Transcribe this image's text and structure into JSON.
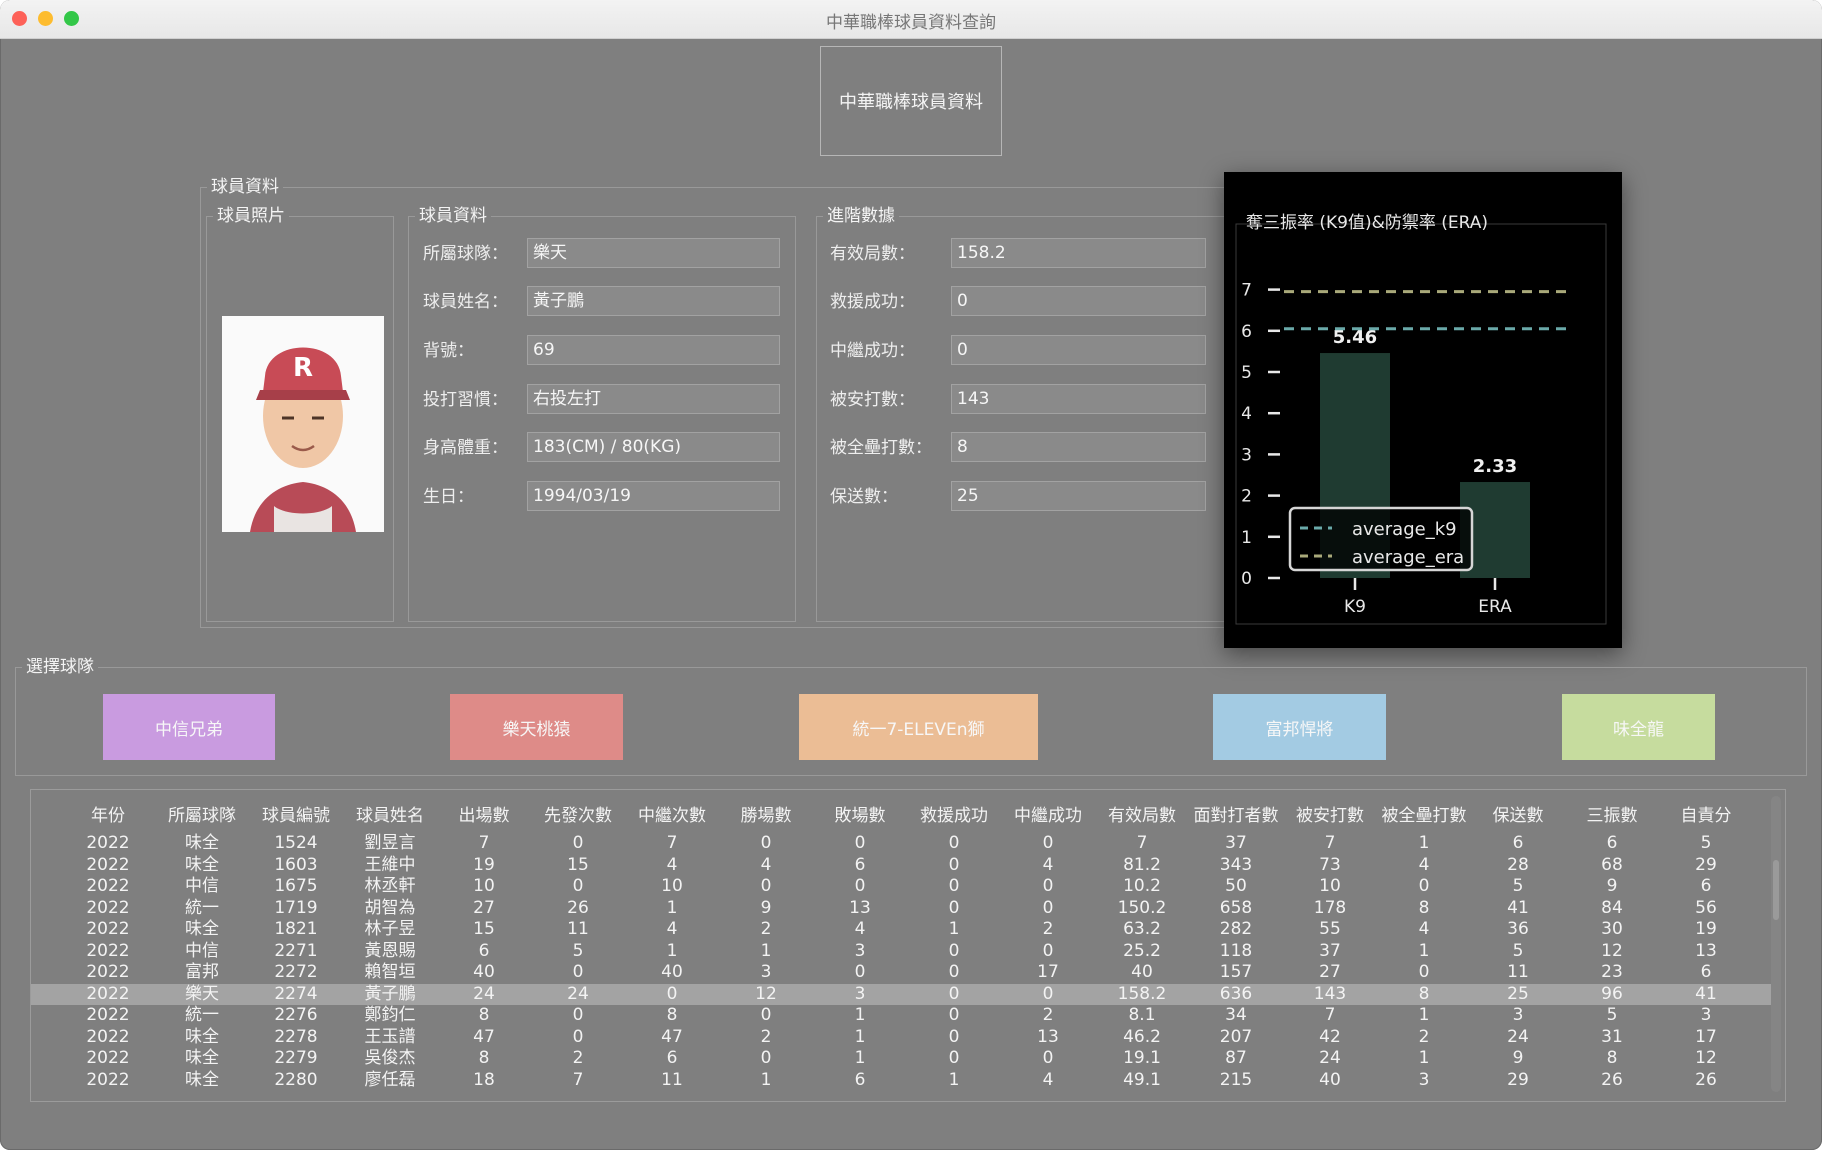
{
  "window": {
    "title": "中華職棒球員資料查詢"
  },
  "header": {
    "title": "中華職棒球員資料"
  },
  "player_section": {
    "label": "球員資料"
  },
  "photo_section": {
    "label": "球員照片",
    "cap_letter": "R"
  },
  "info_section": {
    "label": "球員資料",
    "rows": [
      {
        "label": "所屬球隊：",
        "value": "樂天"
      },
      {
        "label": "球員姓名：",
        "value": "黃子鵬"
      },
      {
        "label": "背號：",
        "value": "69"
      },
      {
        "label": "投打習慣：",
        "value": "右投左打"
      },
      {
        "label": "身高體重：",
        "value": "183(CM) / 80(KG)"
      },
      {
        "label": "生日：",
        "value": "1994/03/19"
      }
    ]
  },
  "advanced_section": {
    "label": "進階數據",
    "rows": [
      {
        "label": "有效局數：",
        "value": "158.2"
      },
      {
        "label": "救援成功：",
        "value": "0"
      },
      {
        "label": "中繼成功：",
        "value": "0"
      },
      {
        "label": "被安打數：",
        "value": "143"
      },
      {
        "label": "被全壘打數：",
        "value": "8"
      },
      {
        "label": "保送數：",
        "value": "25"
      }
    ]
  },
  "chart_data": {
    "type": "bar",
    "title": "奪三振率 (K9值)&防禦率 (ERA)",
    "categories": [
      "K9",
      "ERA"
    ],
    "values": [
      5.46,
      2.33
    ],
    "value_labels": [
      "5.46",
      "2.33"
    ],
    "yticks": [
      "0",
      "1",
      "2",
      "3",
      "4",
      "5",
      "6",
      "7"
    ],
    "ylim": [
      0,
      7
    ],
    "reference_lines": [
      {
        "name": "average_k9",
        "value": 6.05,
        "color": "#6aa9a9"
      },
      {
        "name": "average_era",
        "value": 6.95,
        "color": "#a9a97a"
      }
    ],
    "bar_color": "#1f3b31",
    "legend_position": "lower-left",
    "grid": false
  },
  "team_section": {
    "label": "選擇球隊",
    "teams": [
      {
        "name": "中信兄弟",
        "color": "#c99be0"
      },
      {
        "name": "樂天桃猿",
        "color": "#de8b88"
      },
      {
        "name": "統一7-ELEVEn獅",
        "color": "#ebbd95"
      },
      {
        "name": "富邦悍將",
        "color": "#a3cbe3"
      },
      {
        "name": "味全龍",
        "color": "#c6dc9e"
      }
    ]
  },
  "table": {
    "columns": [
      "年份",
      "所屬球隊",
      "球員編號",
      "球員姓名",
      "出場數",
      "先發次數",
      "中繼次數",
      "勝場數",
      "敗場數",
      "救援成功",
      "中繼成功",
      "有效局數",
      "面對打者數",
      "被安打數",
      "被全壘打數",
      "保送數",
      "三振數",
      "自責分"
    ],
    "selected_index": 7,
    "rows": [
      [
        "2022",
        "味全",
        "1524",
        "劉昱言",
        "7",
        "0",
        "7",
        "0",
        "0",
        "0",
        "0",
        "7",
        "37",
        "7",
        "1",
        "6",
        "6",
        "5"
      ],
      [
        "2022",
        "味全",
        "1603",
        "王維中",
        "19",
        "15",
        "4",
        "4",
        "6",
        "0",
        "4",
        "81.2",
        "343",
        "73",
        "4",
        "28",
        "68",
        "29"
      ],
      [
        "2022",
        "中信",
        "1675",
        "林丞軒",
        "10",
        "0",
        "10",
        "0",
        "0",
        "0",
        "0",
        "10.2",
        "50",
        "10",
        "0",
        "5",
        "9",
        "6"
      ],
      [
        "2022",
        "統一",
        "1719",
        "胡智為",
        "27",
        "26",
        "1",
        "9",
        "13",
        "0",
        "0",
        "150.2",
        "658",
        "178",
        "8",
        "41",
        "84",
        "56"
      ],
      [
        "2022",
        "味全",
        "1821",
        "林子昱",
        "15",
        "11",
        "4",
        "2",
        "4",
        "1",
        "2",
        "63.2",
        "282",
        "55",
        "4",
        "36",
        "30",
        "19"
      ],
      [
        "2022",
        "中信",
        "2271",
        "黃恩賜",
        "6",
        "5",
        "1",
        "1",
        "3",
        "0",
        "0",
        "25.2",
        "118",
        "37",
        "1",
        "5",
        "12",
        "13"
      ],
      [
        "2022",
        "富邦",
        "2272",
        "賴智垣",
        "40",
        "0",
        "40",
        "3",
        "0",
        "0",
        "17",
        "40",
        "157",
        "27",
        "0",
        "11",
        "23",
        "6"
      ],
      [
        "2022",
        "樂天",
        "2274",
        "黃子鵬",
        "24",
        "24",
        "0",
        "12",
        "3",
        "0",
        "0",
        "158.2",
        "636",
        "143",
        "8",
        "25",
        "96",
        "41"
      ],
      [
        "2022",
        "統一",
        "2276",
        "鄭鈞仁",
        "8",
        "0",
        "8",
        "0",
        "1",
        "0",
        "2",
        "8.1",
        "34",
        "7",
        "1",
        "3",
        "5",
        "3"
      ],
      [
        "2022",
        "味全",
        "2278",
        "王玉譜",
        "47",
        "0",
        "47",
        "2",
        "1",
        "0",
        "13",
        "46.2",
        "207",
        "42",
        "2",
        "24",
        "31",
        "17"
      ],
      [
        "2022",
        "味全",
        "2279",
        "吳俊杰",
        "8",
        "2",
        "6",
        "0",
        "1",
        "0",
        "0",
        "19.1",
        "87",
        "24",
        "1",
        "9",
        "8",
        "12"
      ],
      [
        "2022",
        "味全",
        "2280",
        "廖任磊",
        "18",
        "7",
        "11",
        "1",
        "6",
        "1",
        "4",
        "49.1",
        "215",
        "40",
        "3",
        "29",
        "26",
        "26"
      ]
    ]
  }
}
